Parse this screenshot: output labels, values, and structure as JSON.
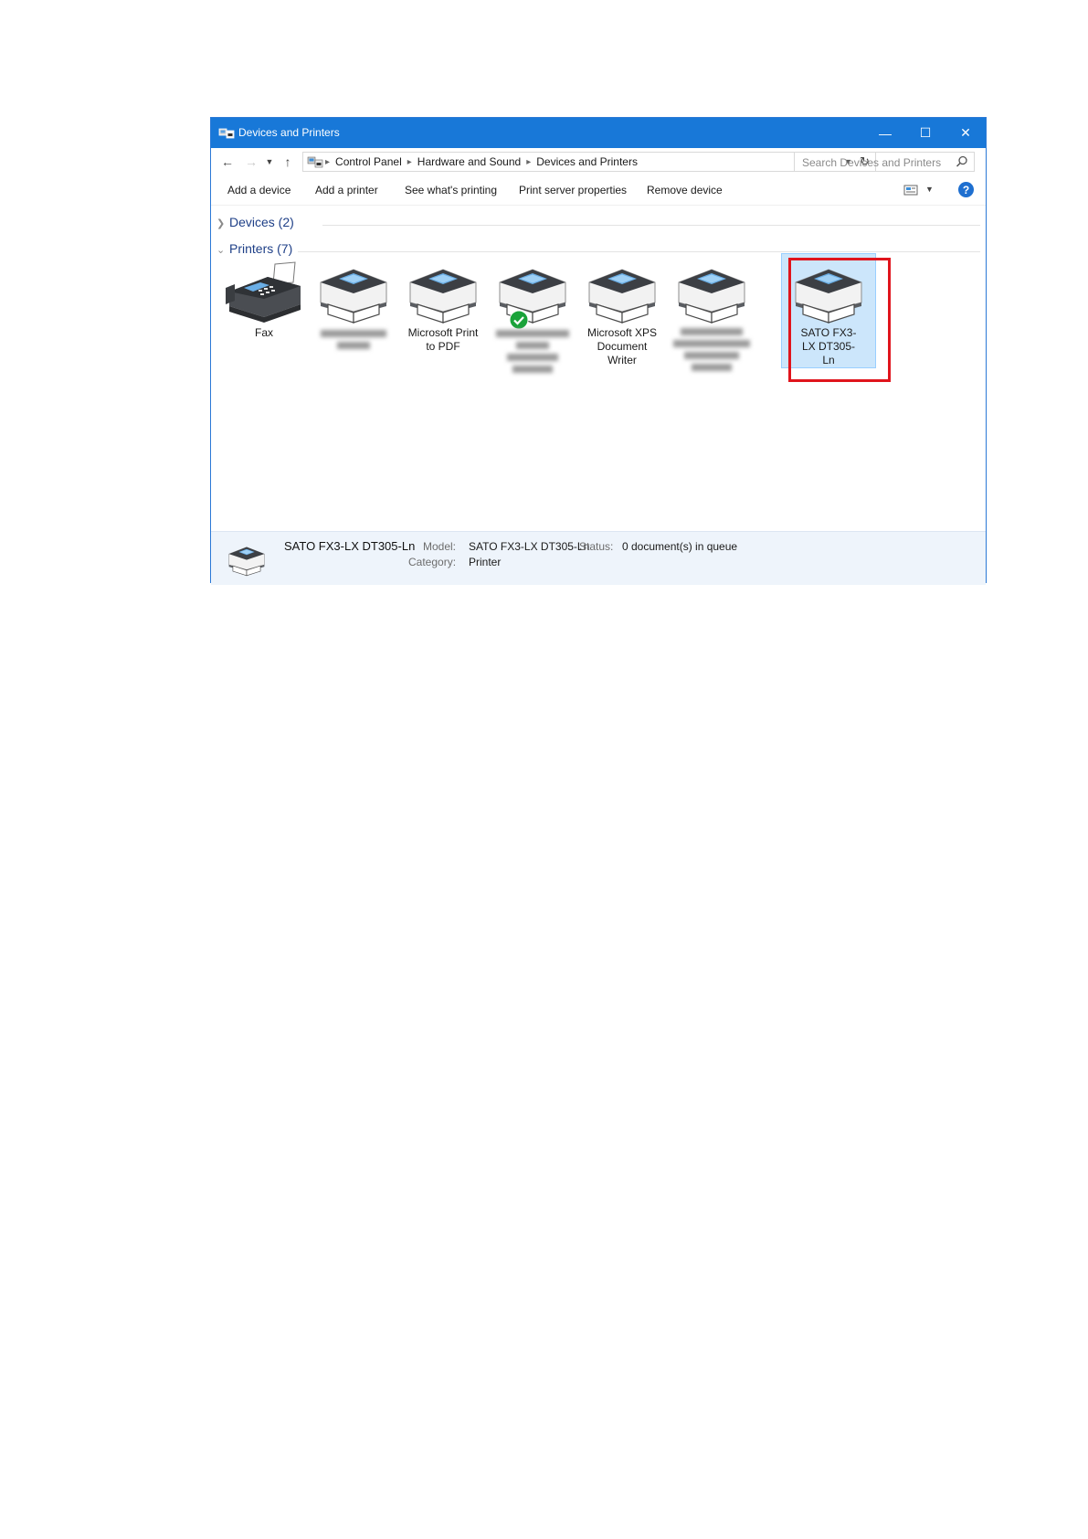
{
  "window": {
    "title": "Devices and Printers",
    "minimize_label": "—",
    "maximize_label": "☐",
    "close_label": "✕"
  },
  "address": {
    "breadcrumbs": [
      "Control Panel",
      "Hardware and Sound",
      "Devices and Printers"
    ],
    "search_placeholder": "Search Devices and Printers"
  },
  "toolbar": {
    "add_device": "Add a device",
    "add_printer": "Add a printer",
    "see_printing": "See what's printing",
    "print_server": "Print server properties",
    "remove_device": "Remove device",
    "help_label": "?"
  },
  "groups": {
    "devices": "Devices (2)",
    "printers": "Printers (7)"
  },
  "printers": [
    {
      "label": "Fax",
      "icon": "fax-icon"
    },
    {
      "label": "",
      "icon": "printer-icon",
      "blurred": true
    },
    {
      "label": "Microsoft Print to PDF",
      "icon": "printer-icon"
    },
    {
      "label": "",
      "icon": "printer-icon",
      "blurred": true,
      "default": true
    },
    {
      "label": "Microsoft XPS Document Writer",
      "icon": "printer-icon"
    },
    {
      "label": "",
      "icon": "printer-icon",
      "blurred": true
    },
    {
      "label": "SATO FX3-LX DT305-Ln",
      "icon": "printer-icon",
      "selected": true
    }
  ],
  "details": {
    "name": "SATO FX3-LX DT305-Ln",
    "model_key": "Model:",
    "model_value": "SATO FX3-LX DT305-Ln",
    "status_key": "Status:",
    "status_value": "0 document(s) in queue",
    "category_key": "Category:",
    "category_value": "Printer"
  },
  "colors": {
    "titlebar": "#1878d8",
    "selection": "#cce6fb",
    "highlight_frame": "#e0141c",
    "default_check": "#1aa33a"
  }
}
